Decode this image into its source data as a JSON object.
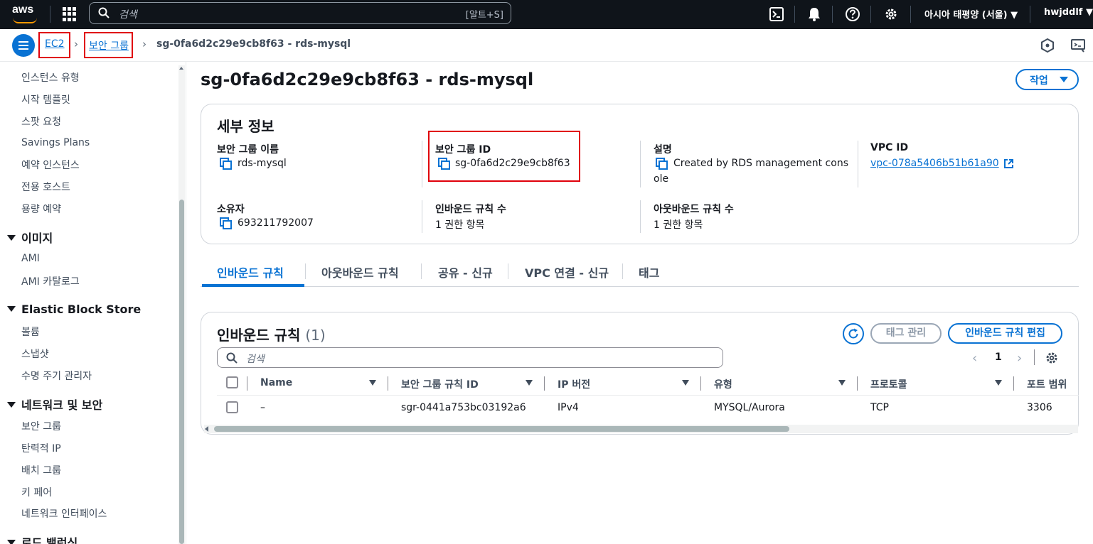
{
  "topnav": {
    "logo_text": "aws",
    "search_placeholder": "검색",
    "search_shortcut": "[알트+S]",
    "region": "아시아 태평양 (서울) ▼",
    "user": "hwjddlf ▼"
  },
  "breadcrumb": {
    "ec2": "EC2",
    "security_groups": "보안 그룹",
    "current": "sg-0fa6d2c29e9cb8f63 - rds-mysql"
  },
  "sidebar": {
    "items_top": [
      "인스턴스 유형",
      "시작 템플릿",
      "스팟 요청",
      "Savings Plans",
      "예약 인스턴스",
      "전용 호스트",
      "용량 예약"
    ],
    "images_head": "이미지",
    "images_items": [
      "AMI",
      "AMI 카탈로그"
    ],
    "ebs_head": "Elastic Block Store",
    "ebs_items": [
      "볼륨",
      "스냅샷",
      "수명 주기 관리자"
    ],
    "net_head": "네트워크 및 보안",
    "net_items": [
      "보안 그룹",
      "탄력적 IP",
      "배치 그룹",
      "키 페어",
      "네트워크 인터페이스"
    ],
    "lb_head": "로드 밸런싱"
  },
  "page": {
    "title": "sg-0fa6d2c29e9cb8f63 - rds-mysql",
    "action_label": "작업"
  },
  "details": {
    "title": "세부 정보",
    "sg_name_label": "보안 그룹 이름",
    "sg_name": "rds-mysql",
    "sg_id_label": "보안 그룹 ID",
    "sg_id": "sg-0fa6d2c29e9cb8f63",
    "desc_label": "설명",
    "desc_line1": "Created by RDS management cons",
    "desc_line2": "ole",
    "vpc_label": "VPC ID",
    "vpc_id": "vpc-078a5406b51b61a90",
    "owner_label": "소유자",
    "owner": "693211792007",
    "inbound_count_label": "인바운드 규칙 수",
    "inbound_count": "1 권한 항목",
    "outbound_count_label": "아웃바운드 규칙 수",
    "outbound_count": "1 권한 항목"
  },
  "tabs": [
    {
      "label": "인바운드 규칙"
    },
    {
      "label": "아웃바운드 규칙"
    },
    {
      "label": "공유 - 신규"
    },
    {
      "label": "VPC 연결 - 신규"
    },
    {
      "label": "태그"
    }
  ],
  "inbound": {
    "title": "인바운드 규칙",
    "count": "(1)",
    "tag_btn": "태그 관리",
    "edit_btn": "인바운드 규칙 편집",
    "search_placeholder": "검색",
    "page": "1",
    "columns": [
      "Name",
      "보안 그룹 규칙 ID",
      "IP 버전",
      "유형",
      "프로토콜",
      "포트 범위"
    ],
    "rows": [
      [
        "–",
        "sgr-0441a753bc03192a6",
        "IPv4",
        "MYSQL/Aurora",
        "TCP",
        "3306"
      ]
    ]
  }
}
